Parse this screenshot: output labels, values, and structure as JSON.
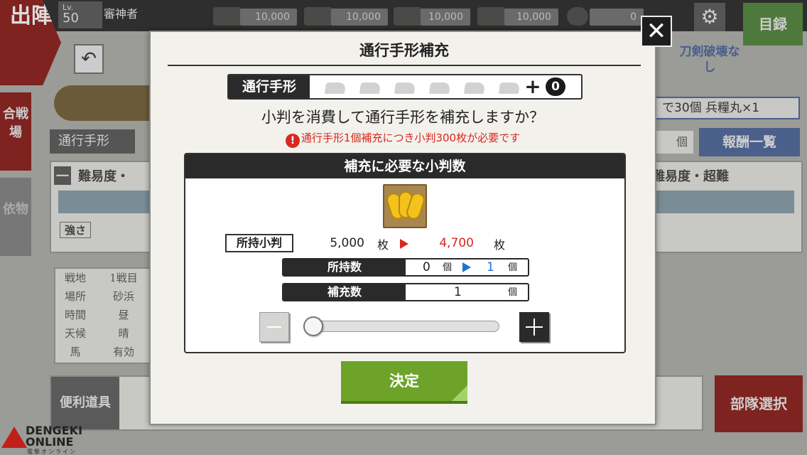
{
  "background": {
    "sortie_tab": "出陣",
    "level_label": "Lv.",
    "level_value": "50",
    "player_name": "審神者",
    "resources": [
      "10,000",
      "10,000",
      "10,000",
      "10,000"
    ],
    "koban_top": "0",
    "catalog": "目録",
    "side_tabs": [
      "合戦場",
      "依物"
    ],
    "permit_label": "通行手形",
    "difficulty_left": "難易度・",
    "difficulty_left_prefix": "一",
    "difficulty_right": "難易度・超難",
    "strength": "強さ",
    "sword_break": "刀剣破壊なし",
    "info_text": "で30個 兵糧丸×1",
    "kosu": "個",
    "reward_list": "報酬一覧",
    "table_header_1": "戦地",
    "table_header_2": "1戦目",
    "table_rows": [
      {
        "label": "場所",
        "value": "砂浜"
      },
      {
        "label": "時間",
        "value": "昼"
      },
      {
        "label": "天候",
        "value": "晴"
      },
      {
        "label": "馬",
        "value": "有効"
      }
    ],
    "tools": "便利道具",
    "team_select": "部隊選択",
    "watermark_line1": "DENGEKI",
    "watermark_line2": "ONLINE",
    "watermark_sub": "電撃オンライン"
  },
  "dialog": {
    "title": "通行手形補充",
    "close_icon": "✕",
    "permit_label": "通行手形",
    "permit_slots": 6,
    "permit_plus": "+",
    "permit_count": "0",
    "question": "小判を消費して通行手形を補充しますか？",
    "warning_icon": "!",
    "warning": "通行手形1個補充につき小判300枚が必要です",
    "panel_title": "補充に必要な小判数",
    "holding_label": "所持小判",
    "koban_before": "5,000",
    "koban_unit": "枚",
    "koban_after": "4,700",
    "owned_label": "所持数",
    "owned_before": "0",
    "owned_after": "1",
    "count_unit": "個",
    "refill_label": "補充数",
    "refill_value": "1",
    "slider_value": 0,
    "confirm": "決定"
  },
  "colors": {
    "accent_red": "#d9281e",
    "accent_blue": "#1f73d8",
    "confirm_green": "#6ea32a"
  }
}
